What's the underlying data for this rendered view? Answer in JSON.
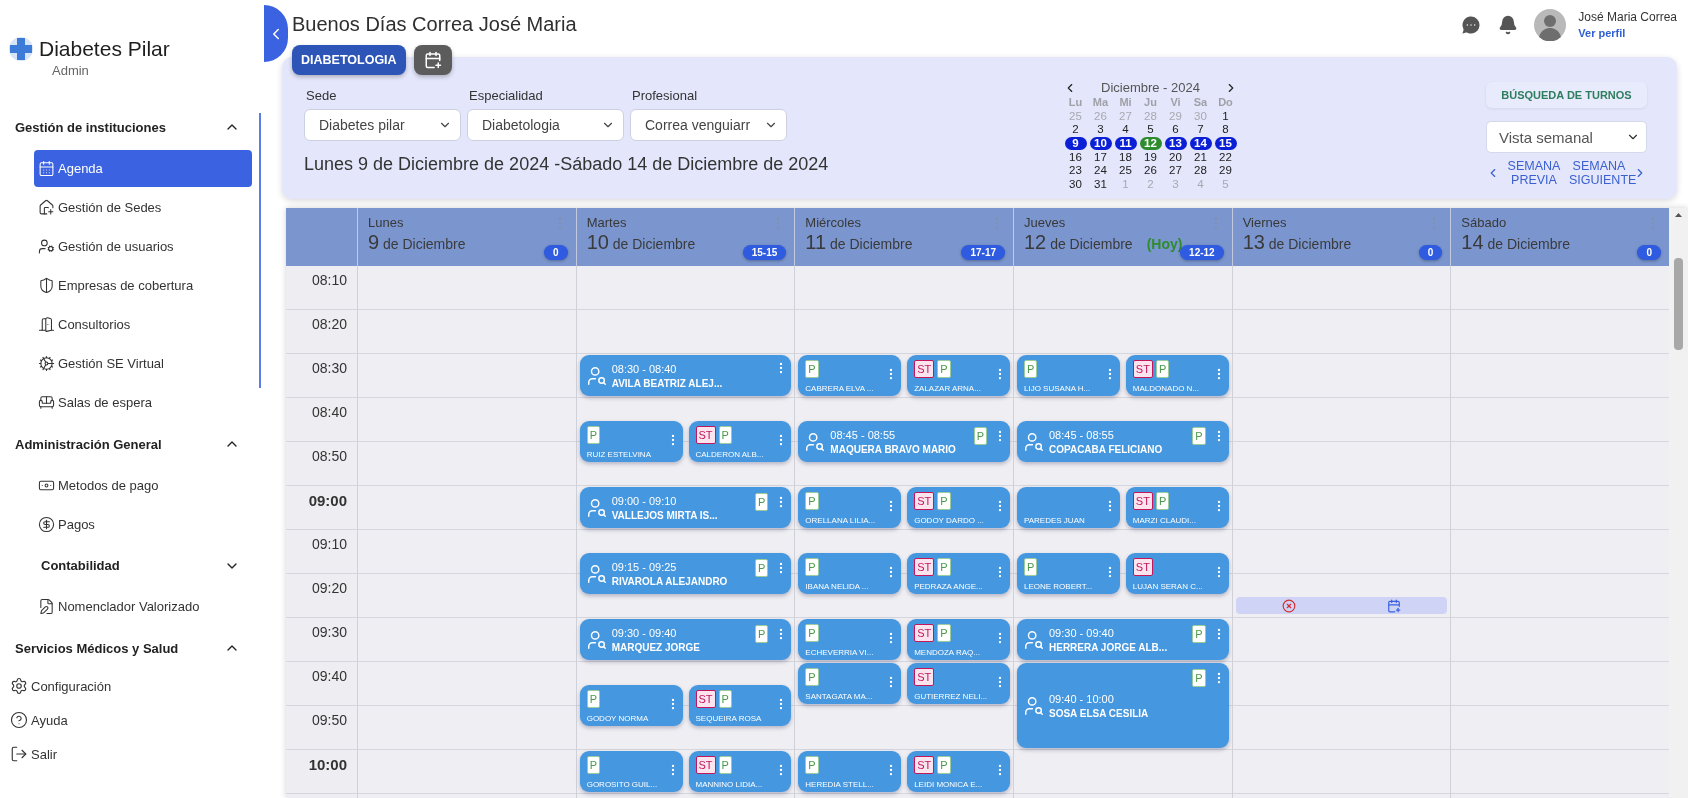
{
  "sidebar": {
    "brand": "Diabetes Pilar",
    "role": "Admin",
    "sections": [
      {
        "title": "Gestión de instituciones",
        "expanded": true,
        "items": [
          {
            "kind": "item",
            "label": "Agenda",
            "selected": true
          },
          {
            "kind": "item",
            "label": "Gestión de Sedes",
            "selected": false
          },
          {
            "kind": "item",
            "label": "Gestión de usuarios",
            "selected": false
          },
          {
            "kind": "item",
            "label": "Empresas de cobertura",
            "selected": false
          },
          {
            "kind": "item",
            "label": "Consultorios",
            "selected": false
          },
          {
            "kind": "item",
            "label": "Gestión SE Virtual",
            "selected": false
          },
          {
            "kind": "item",
            "label": "Salas de espera",
            "selected": false
          }
        ]
      },
      {
        "title": "Administración General",
        "expanded": true,
        "items": [
          {
            "kind": "item",
            "label": "Metodos de pago",
            "selected": false
          },
          {
            "kind": "item",
            "label": "Pagos",
            "selected": false
          },
          {
            "kind": "group",
            "label": "Contabilidad",
            "expanded": false
          },
          {
            "kind": "item",
            "label": "Nomenclador Valorizado",
            "selected": false
          }
        ]
      },
      {
        "title": "Servicios Médicos y Salud",
        "expanded": true
      }
    ],
    "footer": [
      "Configuración",
      "Ayuda",
      "Salir"
    ]
  },
  "header": {
    "greeting": "Buenos Días Correa José Maria",
    "user_name": "José Maria Correa",
    "profile_link": "Ver perfil"
  },
  "tabs": [
    {
      "label": "DIABETOLOGIA",
      "selected": true
    }
  ],
  "filters": [
    {
      "label": "Sede",
      "value": "Diabetes pilar"
    },
    {
      "label": "Especialidad",
      "value": "Diabetologia"
    },
    {
      "label": "Profesional",
      "value": "Correa venguiarr"
    }
  ],
  "range": "Lunes 9 de Diciembre de 2024 -Sábado 14 de Diciembre de 2024",
  "mini_calendar": {
    "title": "Diciembre - 2024",
    "weekdays": [
      "Lu",
      "Ma",
      "Mi",
      "Ju",
      "Vi",
      "Sa",
      "Do"
    ],
    "weeks": [
      [
        {
          "day": "25",
          "muted": true,
          "selected": false,
          "today": false
        },
        {
          "day": "26",
          "muted": true,
          "selected": false,
          "today": false
        },
        {
          "day": "27",
          "muted": true,
          "selected": false,
          "today": false
        },
        {
          "day": "28",
          "muted": true,
          "selected": false,
          "today": false
        },
        {
          "day": "29",
          "muted": true,
          "selected": false,
          "today": false
        },
        {
          "day": "30",
          "muted": true,
          "selected": false,
          "today": false
        },
        {
          "day": "1",
          "muted": false,
          "selected": false,
          "today": false
        }
      ],
      [
        {
          "day": "2",
          "muted": false,
          "selected": false,
          "today": false
        },
        {
          "day": "3",
          "muted": false,
          "selected": false,
          "today": false
        },
        {
          "day": "4",
          "muted": false,
          "selected": false,
          "today": false
        },
        {
          "day": "5",
          "muted": false,
          "selected": false,
          "today": false
        },
        {
          "day": "6",
          "muted": false,
          "selected": false,
          "today": false
        },
        {
          "day": "7",
          "muted": false,
          "selected": false,
          "today": false
        },
        {
          "day": "8",
          "muted": false,
          "selected": false,
          "today": false
        }
      ],
      [
        {
          "day": "9",
          "muted": false,
          "selected": true,
          "today": false
        },
        {
          "day": "10",
          "muted": false,
          "selected": true,
          "today": false
        },
        {
          "day": "11",
          "muted": false,
          "selected": true,
          "today": false
        },
        {
          "day": "12",
          "muted": false,
          "selected": true,
          "today": true
        },
        {
          "day": "13",
          "muted": false,
          "selected": true,
          "today": false
        },
        {
          "day": "14",
          "muted": false,
          "selected": true,
          "today": false
        },
        {
          "day": "15",
          "muted": false,
          "selected": true,
          "today": false
        }
      ],
      [
        {
          "day": "16",
          "muted": false,
          "selected": false,
          "today": false
        },
        {
          "day": "17",
          "muted": false,
          "selected": false,
          "today": false
        },
        {
          "day": "18",
          "muted": false,
          "selected": false,
          "today": false
        },
        {
          "day": "19",
          "muted": false,
          "selected": false,
          "today": false
        },
        {
          "day": "20",
          "muted": false,
          "selected": false,
          "today": false
        },
        {
          "day": "21",
          "muted": false,
          "selected": false,
          "today": false
        },
        {
          "day": "22",
          "muted": false,
          "selected": false,
          "today": false
        }
      ],
      [
        {
          "day": "23",
          "muted": false,
          "selected": false,
          "today": false
        },
        {
          "day": "24",
          "muted": false,
          "selected": false,
          "today": false
        },
        {
          "day": "25",
          "muted": false,
          "selected": false,
          "today": false
        },
        {
          "day": "26",
          "muted": false,
          "selected": false,
          "today": false
        },
        {
          "day": "27",
          "muted": false,
          "selected": false,
          "today": false
        },
        {
          "day": "28",
          "muted": false,
          "selected": false,
          "today": false
        },
        {
          "day": "29",
          "muted": false,
          "selected": false,
          "today": false
        }
      ],
      [
        {
          "day": "30",
          "muted": false,
          "selected": false,
          "today": false
        },
        {
          "day": "31",
          "muted": false,
          "selected": false,
          "today": false
        },
        {
          "day": "1",
          "muted": true,
          "selected": false,
          "today": false
        },
        {
          "day": "2",
          "muted": true,
          "selected": false,
          "today": false
        },
        {
          "day": "3",
          "muted": true,
          "selected": false,
          "today": false
        },
        {
          "day": "4",
          "muted": true,
          "selected": false,
          "today": false
        },
        {
          "day": "5",
          "muted": true,
          "selected": false,
          "today": false
        }
      ]
    ]
  },
  "search_button": "BÚSQUEDA DE TURNOS",
  "view_select": "Vista semanal",
  "prev_week": "SEMANA PREVIA",
  "next_week": "SEMANA SIGUIENTE",
  "schedule": {
    "times": [
      "08:10",
      "08:20",
      "08:30",
      "08:40",
      "08:50",
      "09:00",
      "09:10",
      "09:20",
      "09:30",
      "09:40",
      "09:50",
      "10:00"
    ],
    "days": [
      {
        "weekday": "Lunes",
        "date": "9",
        "month": "de Diciembre",
        "count": "0"
      },
      {
        "weekday": "Martes",
        "date": "10",
        "month": "de Diciembre",
        "count": "15-15",
        "blocks": [
          {
            "kind": "appointments",
            "cards": [
              {
                "kind": "wide",
                "time": "08:30 - 08:40",
                "patient": "AVILA BEATRIZ ALEJ..."
              }
            ]
          },
          {
            "kind": "appointments",
            "cards": [
              {
                "kind": "half",
                "patient": "RUIZ ESTELVINA",
                "badges": [
                  {
                    "kind": "p",
                    "text": "P"
                  }
                ]
              },
              {
                "kind": "half",
                "patient": "CALDERON ALB...",
                "badges": [
                  {
                    "kind": "st",
                    "text": "ST"
                  },
                  {
                    "kind": "p",
                    "text": "P"
                  }
                ]
              }
            ]
          },
          {
            "kind": "appointments",
            "cards": [
              {
                "kind": "wide",
                "time": "09:00 - 09:10",
                "patient": "VALLEJOS MIRTA IS...",
                "badges": [
                  {
                    "kind": "p",
                    "text": "P"
                  }
                ]
              }
            ]
          },
          {
            "kind": "appointments",
            "cards": [
              {
                "kind": "wide",
                "time": "09:15 - 09:25",
                "patient": "RIVAROLA ALEJANDRO",
                "badges": [
                  {
                    "kind": "p",
                    "text": "P"
                  }
                ]
              }
            ]
          },
          {
            "kind": "appointments",
            "cards": [
              {
                "kind": "wide",
                "time": "09:30 - 09:40",
                "patient": "MARQUEZ JORGE",
                "badges": [
                  {
                    "kind": "p",
                    "text": "P"
                  }
                ]
              }
            ]
          },
          {
            "kind": "appointments",
            "cards": [
              {
                "kind": "half",
                "patient": "GODOY NORMA",
                "badges": [
                  {
                    "kind": "p",
                    "text": "P"
                  }
                ]
              },
              {
                "kind": "half",
                "patient": "SEQUEIRA ROSA",
                "badges": [
                  {
                    "kind": "st",
                    "text": "ST"
                  },
                  {
                    "kind": "p",
                    "text": "P"
                  }
                ]
              }
            ]
          },
          {
            "kind": "appointments",
            "cards": [
              {
                "kind": "half",
                "patient": "GOROSITO GUIL...",
                "badges": [
                  {
                    "kind": "p",
                    "text": "P"
                  }
                ]
              },
              {
                "kind": "half",
                "patient": "MANNINO LIDIA...",
                "badges": [
                  {
                    "kind": "st",
                    "text": "ST"
                  },
                  {
                    "kind": "p",
                    "text": "P"
                  }
                ]
              }
            ]
          }
        ]
      },
      {
        "weekday": "Miércoles",
        "date": "11",
        "month": "de Diciembre",
        "count": "17-17",
        "blocks": [
          {
            "kind": "appointments",
            "cards": [
              {
                "kind": "half",
                "patient": "CABRERA ELVA ...",
                "badges": [
                  {
                    "kind": "p",
                    "text": "P"
                  }
                ]
              },
              {
                "kind": "half",
                "patient": "ZALAZAR ARNA...",
                "badges": [
                  {
                    "kind": "st",
                    "text": "ST"
                  },
                  {
                    "kind": "p",
                    "text": "P"
                  }
                ]
              }
            ]
          },
          {
            "kind": "appointments",
            "cards": [
              {
                "kind": "wide",
                "time": "08:45 - 08:55",
                "patient": "MAQUERA BRAVO MARIO",
                "badges": [
                  {
                    "kind": "p",
                    "text": "P"
                  }
                ]
              }
            ]
          },
          {
            "kind": "appointments",
            "cards": [
              {
                "kind": "half",
                "patient": "ORELLANA LILIA...",
                "badges": [
                  {
                    "kind": "p",
                    "text": "P"
                  }
                ]
              },
              {
                "kind": "half",
                "patient": "GODOY DARDO ...",
                "badges": [
                  {
                    "kind": "st",
                    "text": "ST"
                  },
                  {
                    "kind": "p",
                    "text": "P"
                  }
                ]
              }
            ]
          },
          {
            "kind": "appointments",
            "cards": [
              {
                "kind": "half",
                "patient": "IBANA NELIDA ...",
                "badges": [
                  {
                    "kind": "p",
                    "text": "P"
                  }
                ]
              },
              {
                "kind": "half",
                "patient": "PEDRAZA ANGE...",
                "badges": [
                  {
                    "kind": "st",
                    "text": "ST"
                  },
                  {
                    "kind": "p",
                    "text": "P"
                  }
                ]
              }
            ]
          },
          {
            "kind": "appointments",
            "cards": [
              {
                "kind": "half",
                "patient": "ECHEVERRIA VI...",
                "badges": [
                  {
                    "kind": "p",
                    "text": "P"
                  }
                ]
              },
              {
                "kind": "half",
                "patient": "MENDOZA RAQ...",
                "badges": [
                  {
                    "kind": "st",
                    "text": "ST"
                  },
                  {
                    "kind": "p",
                    "text": "P"
                  }
                ]
              }
            ]
          },
          {
            "kind": "appointments",
            "cards": [
              {
                "kind": "half",
                "patient": "SANTAGATA MA...",
                "badges": [
                  {
                    "kind": "p",
                    "text": "P"
                  }
                ]
              },
              {
                "kind": "half",
                "patient": "GUTIERREZ NELI...",
                "badges": [
                  {
                    "kind": "st",
                    "text": "ST"
                  }
                ]
              }
            ]
          },
          {
            "kind": "appointments",
            "cards": [
              {
                "kind": "half",
                "patient": "HEREDIA STELL...",
                "badges": [
                  {
                    "kind": "p",
                    "text": "P"
                  }
                ]
              },
              {
                "kind": "half",
                "patient": "LEIDI MONICA E...",
                "badges": [
                  {
                    "kind": "st",
                    "text": "ST"
                  },
                  {
                    "kind": "p",
                    "text": "P"
                  }
                ]
              }
            ]
          }
        ]
      },
      {
        "weekday": "Jueves",
        "date": "12",
        "month": "de Diciembre",
        "today_label": "(Hoy)",
        "count": "12-12",
        "blocks": [
          {
            "kind": "appointments",
            "cards": [
              {
                "kind": "half",
                "patient": "LIJO SUSANA H...",
                "badges": [
                  {
                    "kind": "p",
                    "text": "P"
                  }
                ]
              },
              {
                "kind": "half",
                "patient": "MALDONADO N...",
                "badges": [
                  {
                    "kind": "st",
                    "text": "ST"
                  },
                  {
                    "kind": "p",
                    "text": "P"
                  }
                ]
              }
            ]
          },
          {
            "kind": "appointments",
            "cards": [
              {
                "kind": "wide",
                "time": "08:45 - 08:55",
                "patient": "COPACABA FELICIANO",
                "badges": [
                  {
                    "kind": "p",
                    "text": "P"
                  }
                ]
              }
            ]
          },
          {
            "kind": "appointments",
            "cards": [
              {
                "kind": "half",
                "patient": "PAREDES JUAN"
              },
              {
                "kind": "half",
                "patient": "MARZI CLAUDI...",
                "badges": [
                  {
                    "kind": "st",
                    "text": "ST"
                  },
                  {
                    "kind": "p",
                    "text": "P"
                  }
                ]
              }
            ]
          },
          {
            "kind": "appointments",
            "cards": [
              {
                "kind": "half",
                "patient": "LEONE ROBERT...",
                "badges": [
                  {
                    "kind": "p",
                    "text": "P"
                  }
                ]
              },
              {
                "kind": "half",
                "patient": "LUJAN SERAN C...",
                "badges": [
                  {
                    "kind": "st",
                    "text": "ST"
                  }
                ]
              }
            ]
          },
          {
            "kind": "appointments",
            "cards": [
              {
                "kind": "wide",
                "time": "09:30 - 09:40",
                "patient": "HERRERA JORGE ALB...",
                "badges": [
                  {
                    "kind": "p",
                    "text": "P"
                  }
                ]
              }
            ]
          },
          {
            "kind": "appointments",
            "cards": [
              {
                "kind": "wide",
                "time": "09:40 - 10:00",
                "patient": "SOSA ELSA CESILIA",
                "badges": [
                  {
                    "kind": "p",
                    "text": "P"
                  }
                ]
              }
            ]
          }
        ]
      },
      {
        "weekday": "Viernes",
        "date": "13",
        "month": "de Diciembre",
        "count": "0",
        "blocks": [
          {
            "kind": "actions"
          }
        ]
      },
      {
        "weekday": "Sábado",
        "date": "14",
        "month": "de Diciembre",
        "count": "0"
      }
    ]
  }
}
